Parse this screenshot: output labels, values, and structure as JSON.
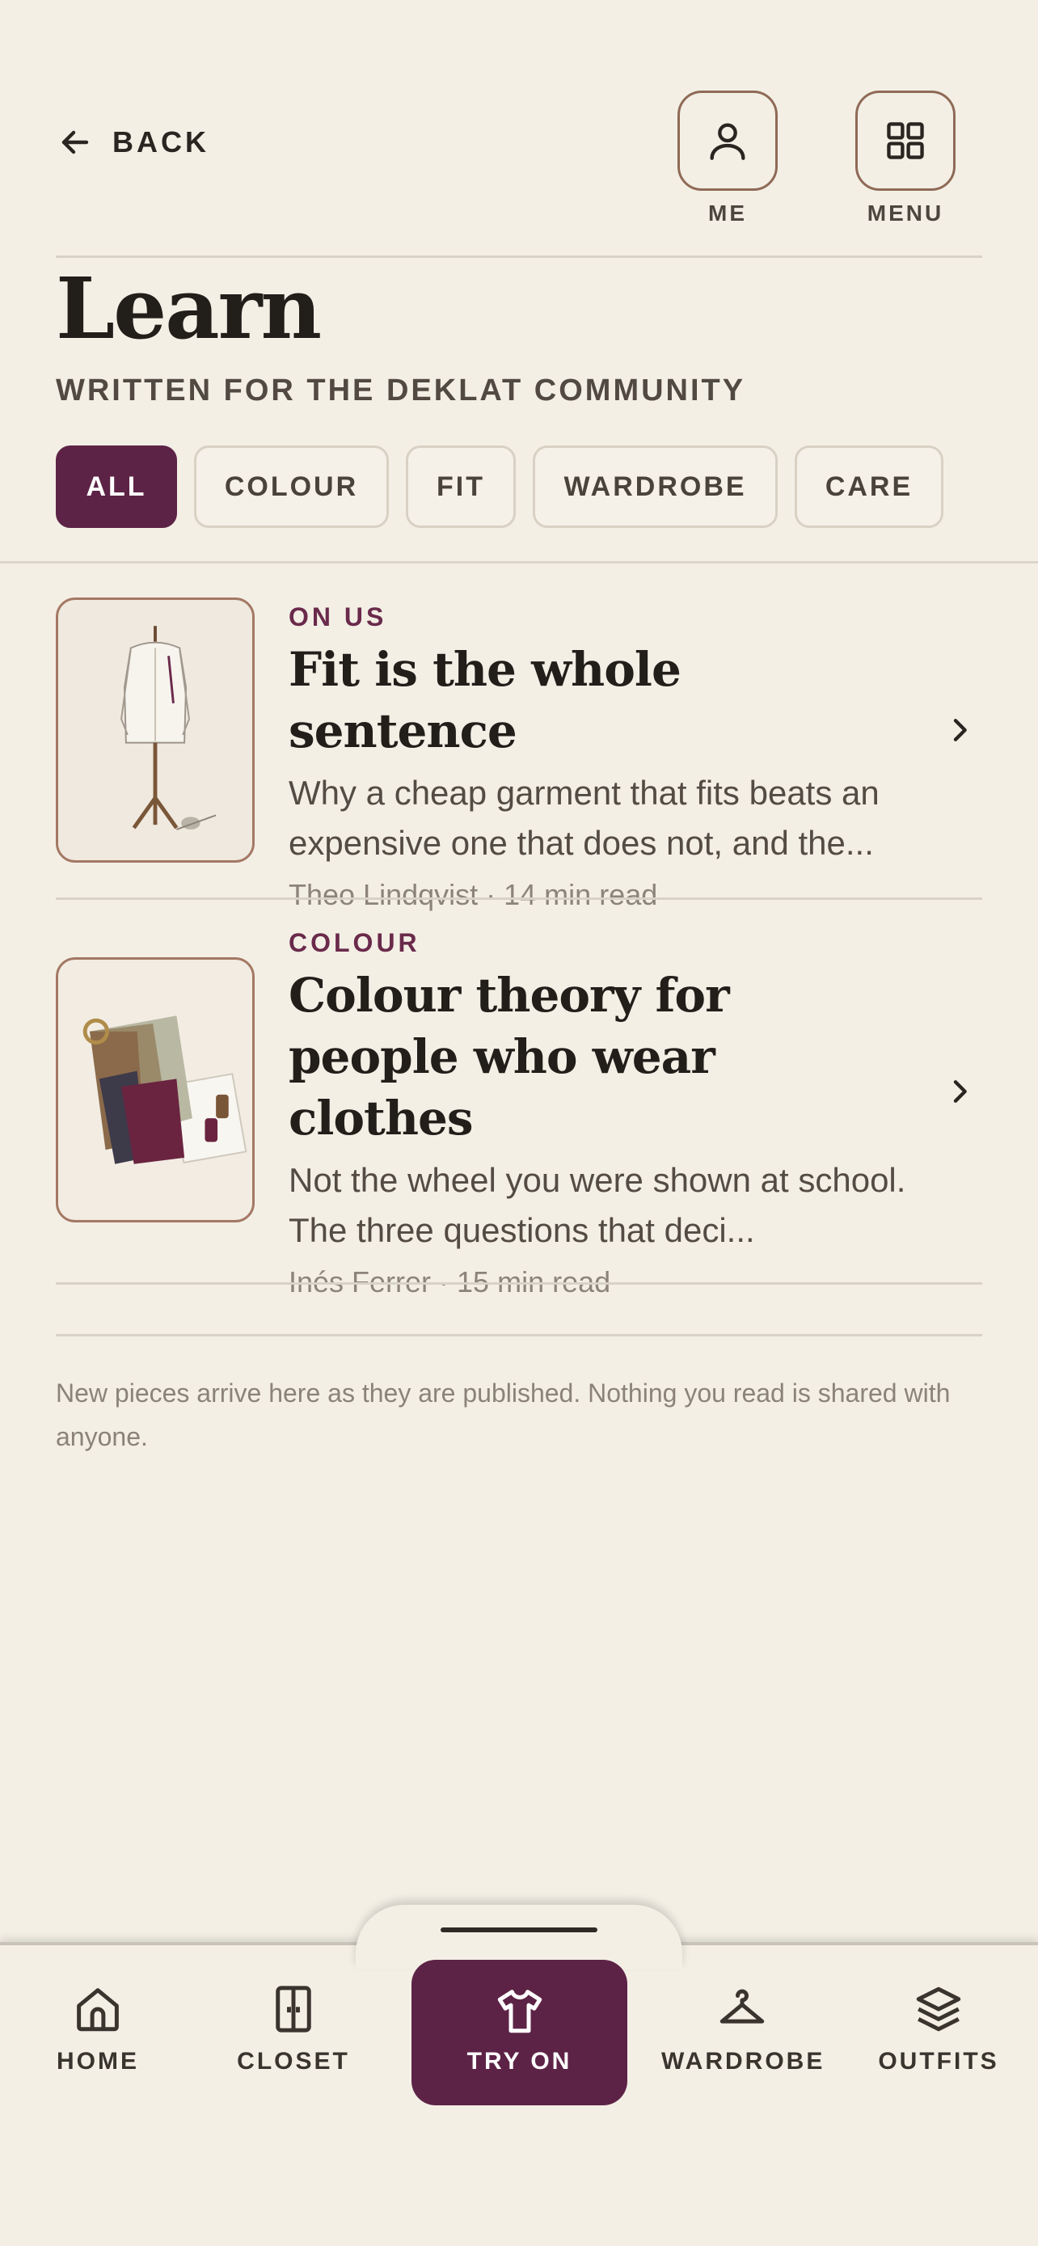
{
  "header": {
    "back_label": "BACK",
    "me_label": "ME",
    "menu_label": "MENU"
  },
  "page": {
    "title": "Learn",
    "subtitle": "WRITTEN FOR THE DEKLAT COMMUNITY"
  },
  "filters": [
    {
      "label": "ALL",
      "active": true
    },
    {
      "label": "COLOUR",
      "active": false
    },
    {
      "label": "FIT",
      "active": false
    },
    {
      "label": "WARDROBE",
      "active": false
    },
    {
      "label": "CARE",
      "active": false
    }
  ],
  "articles": [
    {
      "kicker": "ON US",
      "title": "Fit is the whole sentence",
      "excerpt": "Why a cheap garment that fits beats an expensive one that does not, and the...",
      "meta": "Theo Lindqvist · 14 min read",
      "thumb_icon": "dress-form-illustration"
    },
    {
      "kicker": "COLOUR",
      "title": "Colour theory for people who wear clothes",
      "excerpt": "Not the wheel you were shown at school. The three questions that deci...",
      "meta": "Inés Ferrer · 15 min read",
      "thumb_icon": "fabric-swatches-illustration"
    }
  ],
  "footnote": "New pieces arrive here as they are published. Nothing you read is shared with anyone.",
  "nav": {
    "home": "HOME",
    "closet": "CLOSET",
    "try_on": "TRY ON",
    "wardrobe": "WARDROBE",
    "outfits": "OUTFITS"
  },
  "colors": {
    "background": "#f3efe5",
    "accent": "#5d2346",
    "kicker": "#6a2a4b",
    "border": "#8f6a56"
  }
}
